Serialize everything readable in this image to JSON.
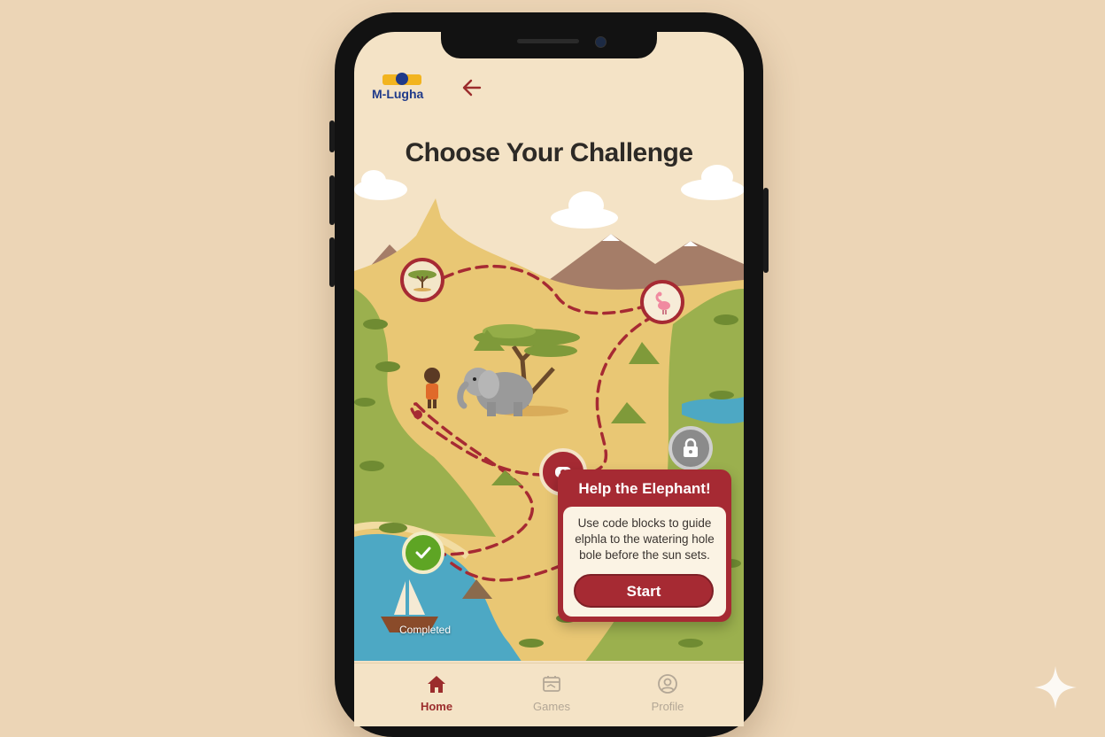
{
  "header": {
    "logo_text": "M-Lugha",
    "back_icon": "arrow-left-icon"
  },
  "page": {
    "title": "Choose Your Challenge"
  },
  "map": {
    "completed_label": "Completed",
    "nodes": [
      {
        "name": "tree",
        "state": "available",
        "icon": "acacia-tree-icon"
      },
      {
        "name": "flamingo",
        "state": "available",
        "icon": "flamingo-icon"
      },
      {
        "name": "locked",
        "state": "locked",
        "icon": "lock-icon"
      },
      {
        "name": "current",
        "state": "current",
        "icon": "elephant-icon"
      },
      {
        "name": "completed",
        "state": "completed",
        "icon": "checkmark-icon"
      }
    ]
  },
  "popup": {
    "title": "Help the Elephant!",
    "body": "Use code blocks to guide elphla to the watering hole bole before the sun sets.",
    "start_label": "Start"
  },
  "nav": {
    "items": [
      {
        "label": "Home",
        "icon": "home-icon",
        "active": true
      },
      {
        "label": "Games",
        "icon": "games-icon",
        "active": false
      },
      {
        "label": "Profile",
        "icon": "profile-icon",
        "active": false
      }
    ]
  },
  "colors": {
    "accent": "#a62a33",
    "background": "#ecd5b6",
    "screen": "#f4e3c6",
    "success": "#5ea524",
    "locked": "#8b8b8b"
  }
}
